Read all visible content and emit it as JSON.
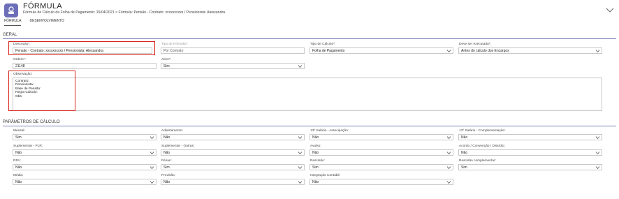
{
  "header": {
    "title": "FÓRMULA",
    "subtitle": "Fórmula de Cálculo da Folha de Pagamento: 15/04/2021  >  Fórmula: Pensão - Contrato: xxxxxxxxxx / Pensionista: Alessandra"
  },
  "tabs": [
    {
      "label": "FÓRMULA",
      "active": true
    },
    {
      "label": "DESENVOLVIMENTO",
      "active": false
    }
  ],
  "geral": {
    "section_title": "GERAL",
    "descricao": {
      "label": "Descrição*:",
      "value": "Pensão - Contrato: xxxxxxxxxx / Pensionista: Alessandra"
    },
    "tipo_formula": {
      "label": "Tipo de Fórmula*:",
      "value": "Por Contrato"
    },
    "tipo_calculo": {
      "label": "Tipo de Cálculo*:",
      "value": "Folha de Pagamento"
    },
    "executada": {
      "label": "Deve ser executada*:",
      "value": "Antes do cálculo dos Encargos"
    },
    "ordem": {
      "label": "Ordem*:",
      "value": "21148"
    },
    "ativo": {
      "label": "Ativo*:",
      "value": "Sim"
    },
    "observacao": {
      "label": "Observação:",
      "lines": [
        "Contrato:",
        "Pensionista:",
        "Base de Pensão:",
        "Regra Cálculo:",
        "Obs:"
      ]
    }
  },
  "parametros": {
    "section_title": "PARÂMETROS DE CÁLCULO",
    "fields": [
      {
        "label": "Mensal:",
        "value": "Sim"
      },
      {
        "label": "Adiantamento:",
        "value": "Não"
      },
      {
        "label": "13º Salário - Antecipação:",
        "value": "Não"
      },
      {
        "label": "13º Salário - Complementação:",
        "value": "Não"
      },
      {
        "label": "Suplementar - PLR:",
        "value": "Não"
      },
      {
        "label": "Suplementar - Outras:",
        "value": "Não"
      },
      {
        "label": "Avulso:",
        "value": "Não"
      },
      {
        "label": "Acordo / Convenção / Dissídio:",
        "value": "Não"
      },
      {
        "label": "RPA:",
        "value": "Não"
      },
      {
        "label": "Férias:",
        "value": "Sim"
      },
      {
        "label": "Rescisão:",
        "value": "Sim"
      },
      {
        "label": "Rescisão complementar:",
        "value": "Sim"
      },
      {
        "label": "Média:",
        "value": "Não"
      },
      {
        "label": "Provisão:",
        "value": "Não"
      },
      {
        "label": "Integração Contábil:",
        "value": "Não"
      }
    ]
  },
  "colors": {
    "accent": "#6c6fb8",
    "highlight": "#d9241d",
    "section_line": "#7b7fb8"
  }
}
